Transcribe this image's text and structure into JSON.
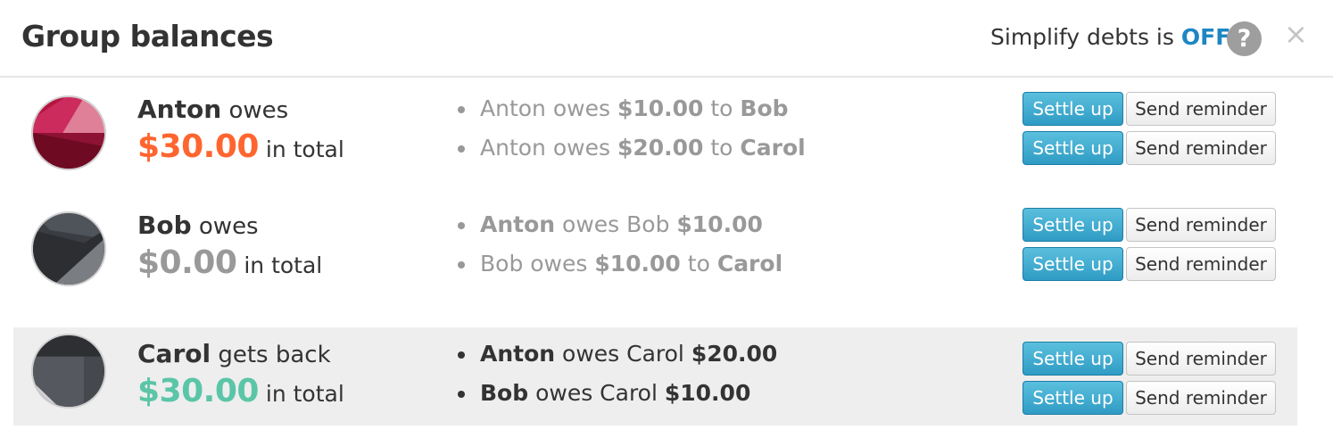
{
  "header": {
    "title": "Group balances",
    "simplify_label": "Simplify debts is",
    "simplify_state": "OFF",
    "help_glyph": "?",
    "close_glyph": "×"
  },
  "colors": {
    "owes": "#ff652f",
    "zero": "#999999",
    "gets_back": "#5bc5a7",
    "accent": "#1e87c3"
  },
  "members": [
    {
      "name": "Anton",
      "verb": "owes",
      "amount": "$30.00",
      "suffix": "in total",
      "debts": [
        {
          "t1": "Anton owes ",
          "b1": "$10.00",
          "t2": " to ",
          "b2": "Bob"
        },
        {
          "t1": "Anton owes ",
          "b1": "$20.00",
          "t2": " to ",
          "b2": "Carol"
        }
      ]
    },
    {
      "name": "Bob",
      "verb": "owes",
      "amount": "$0.00",
      "suffix": "in total",
      "debts": [
        {
          "b1": "Anton",
          "t1": " owes Bob ",
          "b2": "$10.00"
        },
        {
          "t1": "Bob owes ",
          "b1": "$10.00",
          "t2": " to ",
          "b2": "Carol"
        }
      ]
    },
    {
      "name": "Carol",
      "verb": "gets back",
      "amount": "$30.00",
      "suffix": "in total",
      "debts": [
        {
          "b1": "Anton",
          "t1": " owes Carol ",
          "b2": "$20.00"
        },
        {
          "b1": "Bob",
          "t1": " owes Carol ",
          "b2": "$10.00"
        }
      ]
    }
  ],
  "buttons": {
    "settle": "Settle up",
    "remind": "Send reminder"
  }
}
